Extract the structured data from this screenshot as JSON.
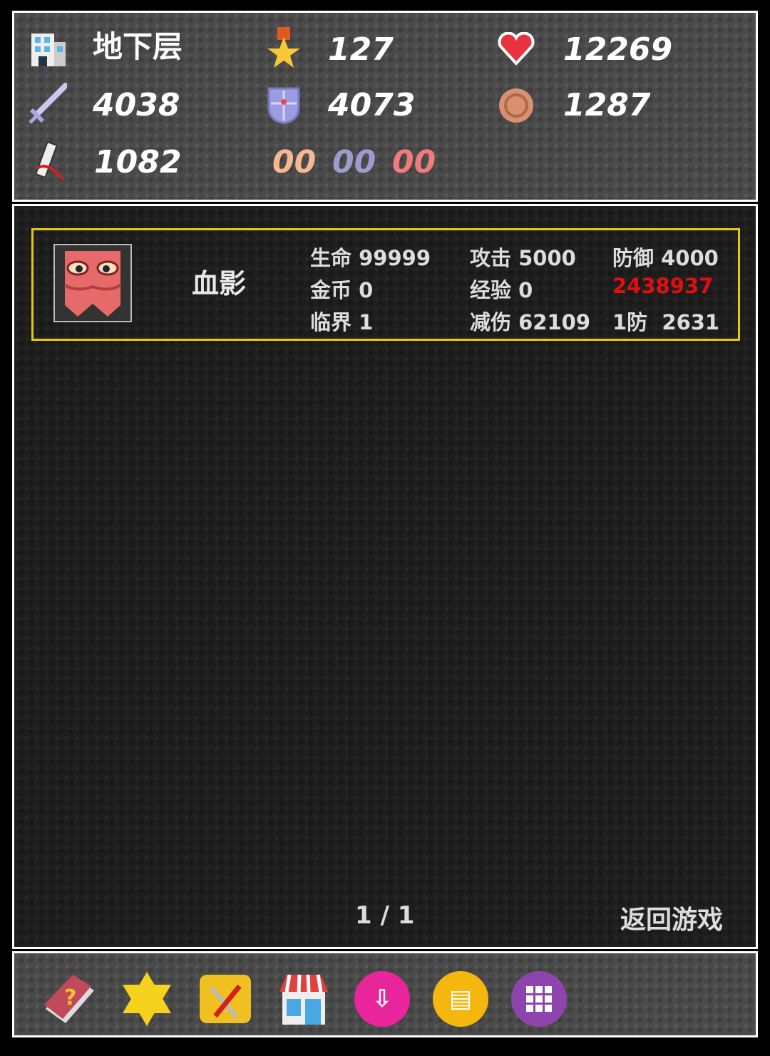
{
  "status": {
    "floor": "地下层",
    "level": "127",
    "hp": "12269",
    "atk": "4038",
    "def": "4073",
    "gold": "1287",
    "exp": "1082",
    "keys": [
      {
        "value": "00",
        "color": "#f6b891"
      },
      {
        "value": "00",
        "color": "#9c9ccf"
      },
      {
        "value": "00",
        "color": "#ef7b7b"
      }
    ]
  },
  "monster": {
    "name": "血影",
    "rows": [
      [
        {
          "label": "生命",
          "value": "99999"
        },
        {
          "label": "攻击",
          "value": "5000"
        },
        {
          "label": "防御",
          "value": "4000"
        }
      ],
      [
        {
          "label": "金币",
          "value": "0"
        },
        {
          "label": "经验",
          "value": "0"
        },
        {
          "label": "",
          "value": "2438937"
        }
      ],
      [
        {
          "label": "临界",
          "value": "1"
        },
        {
          "label": "减伤",
          "value": "62109"
        },
        {
          "label": "1防",
          "value": "2631"
        }
      ]
    ],
    "damage_color": "#e01010"
  },
  "pager": {
    "text": "1 / 1",
    "back_label": "返回游戏"
  },
  "toolbar": [
    "book-icon",
    "fly-star-icon",
    "toolbox-icon",
    "shop-icon",
    "save-icon",
    "load-icon",
    "menu-grid-icon"
  ]
}
